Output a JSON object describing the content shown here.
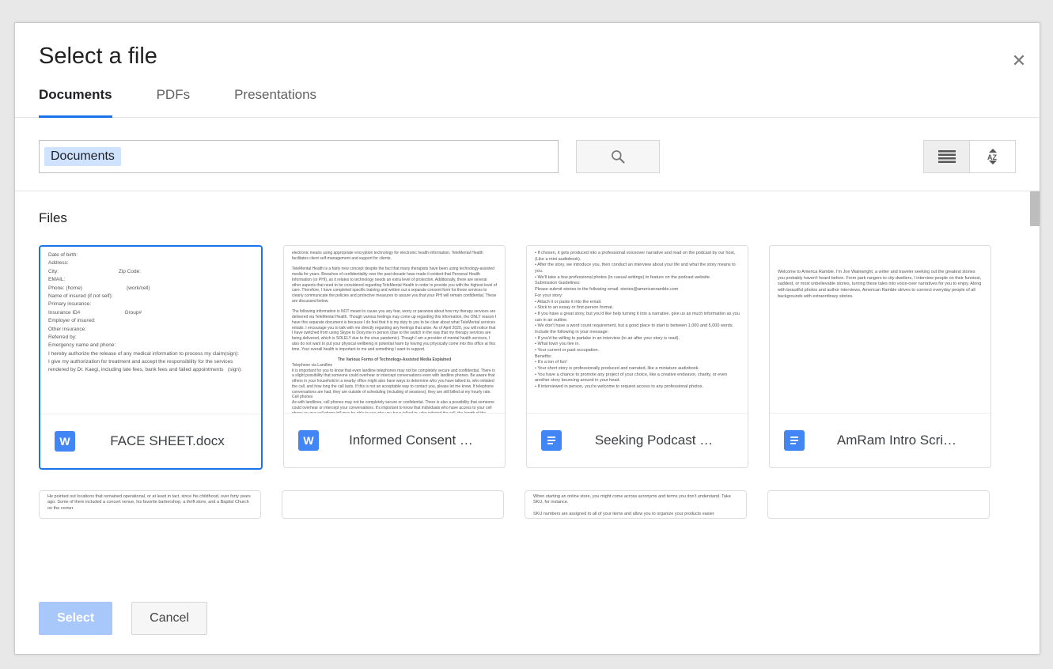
{
  "dialog": {
    "title": "Select a file"
  },
  "tabs": {
    "items": [
      "Documents",
      "PDFs",
      "Presentations"
    ],
    "activeIndex": 0
  },
  "search": {
    "chip": "Documents"
  },
  "section": {
    "label": "Files"
  },
  "files": [
    {
      "name": "FACE SHEET.docx",
      "iconType": "word",
      "selected": true,
      "preview": [
        "Date of birth:",
        "Address:",
        "City:                                          Zip Code:",
        "EMAIL:",
        "Phone: (home)                               (work/cell)",
        "Name of insured (if not self):",
        "Primary insurance:",
        "Insurance ID#                               Group#",
        "Employer of insured:",
        "Other insurance:",
        "Referred by:",
        "Emergency name and phone:",
        "I hereby authorize the release of any medical information to process my claim(sign):",
        "I give my authorization for treatment and accept the responsibility for the services rendered by Dr. Kaegi, including late fees, bank fees and failed appointments   (sign):"
      ]
    },
    {
      "name": "Informed Consent …",
      "iconType": "word",
      "selected": false,
      "preview": [
        "electronic means using appropriate encryption technology for electronic health information. TeleMental Health facilitates client self-management and support for clients.",
        "TeleMental Health is a fairly new concept despite the fact that many therapists have been using technology-assisted media for years. Breaches of confidentiality over the past decade have made it evident that Personal Health Information (or PHI), as it relates to technology needs an extra level of protection. Additionally, there are several other aspects that need to be considered regarding TeleMental Health in order to provide you with the highest level of care. Therefore, I have completed specific training and written out a separate consent form for these services to clearly communicate the policies and protective measures to assure you that your PHI will remain confidential. These are discussed below.",
        "The following information is NOT meant to cause you any fear, worry or paranoia about how my therapy services are delivered via TeleMental Health. Though various feelings may come up regarding this information, the ONLY reason I have this separate document is because I do feel that it is my duty to you to be clear about what TeleMental services entails. I encourage you to talk with me directly regarding any feelings that arise. As of April 2020, you will notice that I have switched from using Skype to Doxy.me in person (due to the switch in the way that my therapy services are being delivered, which is SOLELY due to the virus pandemic). Though I am a provider of mental health services, I also do not want to put your physical wellbeing in potential harm by having you physically come into this office at this time. Your overall health is important to me and something I want to support.",
        "The Various Forms of Technology-Assisted Media Explained",
        "Telephone via Landline",
        "It is important for you to know that even landline telephones may not be completely secure and confidential. There is a slight possibility that someone could overhear or intercept conversations even with landline phones. Be aware that others in your household in a nearby office might also have ways to determine who you have talked to, who initiated the call, and how long the call lasts. If this is not an acceptable way to contact you, please let me know. If telephone conversations are had, they are outside of scheduling (including of sessions); they are still billed at my hourly rate.",
        "Cell phones",
        "As with landlines, cell phones may not be completely secure or confidential. There is also a possibility that someone could overhear or intercept your conversations. It's important to know that individuals who have access to your cell phone or your cell phone bill may be able to see who you have talked to, who initiated the call, the length of the conversation and where each party was located at the time of the call. However, I realize that a vast majority of people nowadays have and use a cell phone. Telephone conversations (other than brief talking about scheduling or setting up appointments) are billed at my hourly rate. Additionally, though your cell phone is stored in my own cell phone, it is only listed by your initials."
      ]
    },
    {
      "name": "Seeking Podcast …",
      "iconType": "docs",
      "selected": false,
      "preview": [
        "• If chosen, it gets produced into a professional voiceover narrative and read on the podcast by our host, (Like a mini audiobook).",
        "• After the story, we introduce you, then conduct an interview about your life and what the story means to you.",
        "• We'll take a few professional photos (in casual settings) to feature on the podcast website.",
        "",
        "Submission Guidelines:",
        "",
        "Please submit stories to the following email: stories@americanramble.com",
        "",
        "For your story:",
        "• Attach it or paste it into the email.",
        "• Stick to an essay or first-person format.",
        "• If you have a great story, but you'd like help turning it into a narrative, give us as much information as you can in an outline.",
        "• We don't have a word count requirement, but a good place to start is between 1,000 and 5,000 words.",
        "",
        "Include the following in your message:",
        "• If you'd be willing to partake in an interview (to air after your story is read).",
        "• What town you live in.",
        "• Your current or past occupation.",
        "",
        "Benefits:",
        "• It's a ton of fun!",
        "• Your short story is professionally produced and narrated, like a miniature audiobook.",
        "• You have a chance to promote any project of your choice, like a creative endeavor, charity, or even another story bouncing around in your head.",
        "• If interviewed in person, you're welcome to request access to any professional photos."
      ]
    },
    {
      "name": "AmRam Intro Scri…",
      "iconType": "docs",
      "selected": false,
      "preview": [
        "Welcome to America Ramble. I'm Joe Wainwright, a writer and traveler seeking out the greatest stories you probably haven't heard before. From park rangers to city dwellers, I interview people on their funniest, saddest, or most unbelievable stories, turning these tales into voice-over narratives for you to enjoy. Along with beautiful photos and author interviews, American Ramble strives to connect everyday people of all backgrounds with extraordinary stories."
      ]
    }
  ],
  "filesRow2Previews": [
    "He pointed out locations that remained operational, or at least in tact, since his childhood, over forty years ago. Some of them included a concert venue, his favorite barbershop, a thrift store, and a Baptist Church on the corner.\n\nAll appeared normal, but it wasn't long until he explained that each played a role in the civil",
    "",
    "When starting an online store, you might come across acronyms and terms you don't understand. Take SKU, for instance.\n\nSKU numbers are assigned to all of your items and allow you to organize your products easier",
    ""
  ],
  "footer": {
    "select": "Select",
    "cancel": "Cancel"
  }
}
